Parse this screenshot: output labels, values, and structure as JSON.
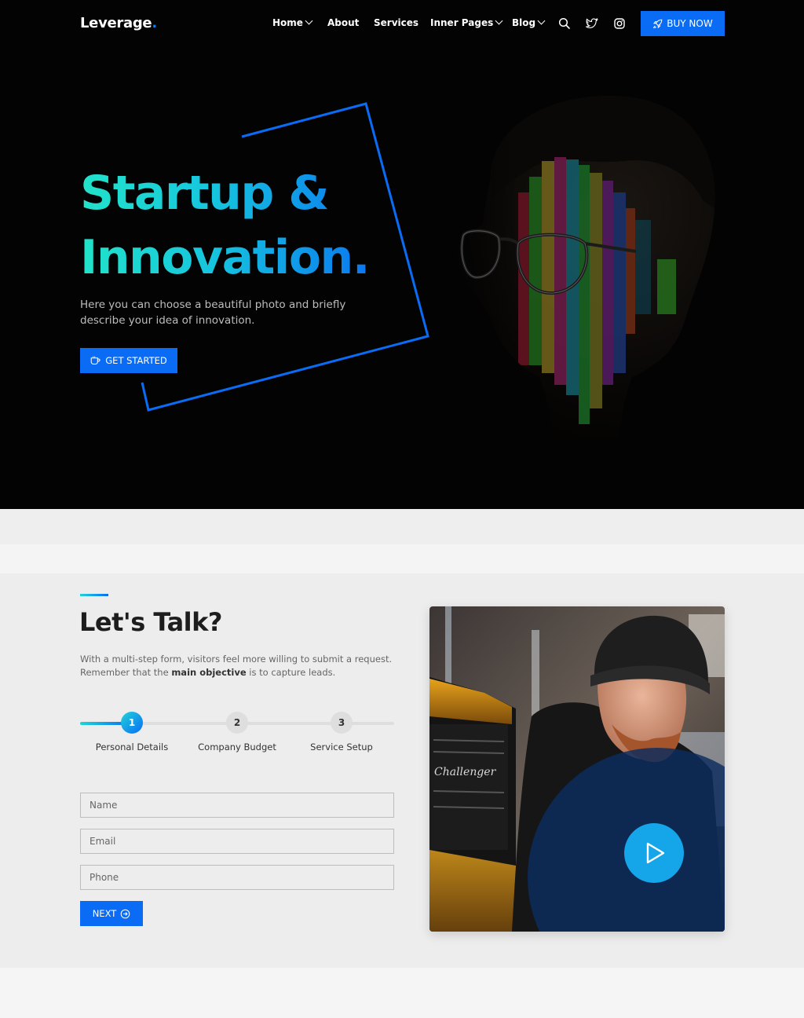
{
  "brand": {
    "name": "Leverage",
    "dot": "."
  },
  "nav": {
    "home": "Home",
    "about": "About",
    "services": "Services",
    "inner_pages": "Inner Pages",
    "blog": "Blog",
    "buy_now": "BUY NOW"
  },
  "hero": {
    "title_line1": "Startup &",
    "title_line2": "Innovation.",
    "description": "Here you can choose a beautiful photo and briefly describe your idea of innovation.",
    "cta": "GET STARTED"
  },
  "contact": {
    "title": "Let's Talk?",
    "desc_part1": "With a multi-step form, visitors feel more willing to submit a request. Remember that the ",
    "desc_bold": "main objective",
    "desc_part2": " is to capture leads.",
    "steps": [
      {
        "number": "1",
        "label": "Personal Details",
        "active": true
      },
      {
        "number": "2",
        "label": "Company Budget",
        "active": false
      },
      {
        "number": "3",
        "label": "Service Setup",
        "active": false
      }
    ],
    "fields": {
      "name_placeholder": "Name",
      "email_placeholder": "Email",
      "phone_placeholder": "Phone"
    },
    "next": "NEXT"
  },
  "icons": {
    "search": "search-icon",
    "twitter": "twitter-icon",
    "instagram": "instagram-icon",
    "rocket": "rocket-icon",
    "coffee": "coffee-icon",
    "arrow_circle": "arrow-right-circle-icon",
    "play": "play-icon"
  },
  "colors": {
    "primary": "#0a6cf5",
    "gradient_start": "#22e3c9",
    "gradient_end": "#0a78f0",
    "hero_bg": "#030303",
    "play_button": "#14a6e8"
  }
}
